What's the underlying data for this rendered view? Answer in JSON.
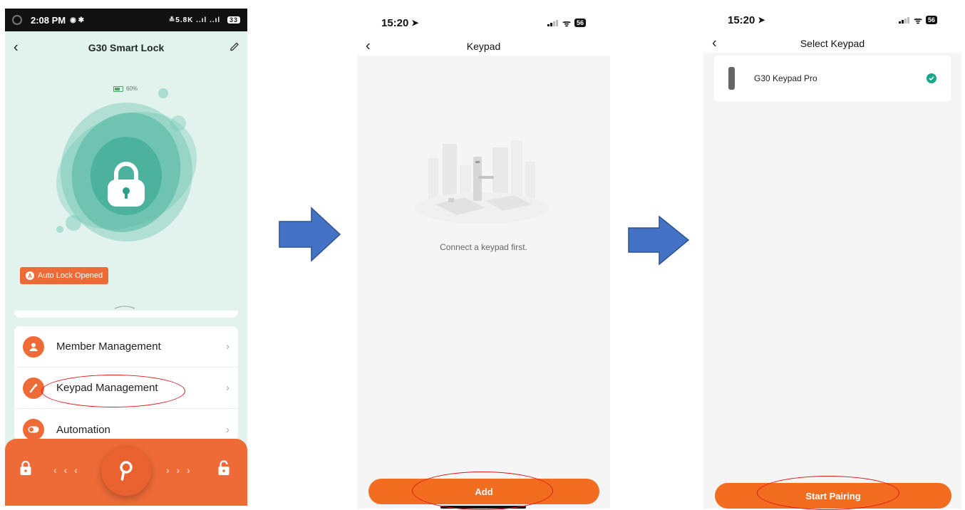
{
  "phone1": {
    "status": {
      "time": "2:08 PM",
      "indicators": "≛5.8K ..ıl ..ıl",
      "battery": "33"
    },
    "header": {
      "title": "G30 Smart Lock",
      "back_icon": "chevron-left-icon",
      "edit_icon": "edit-icon"
    },
    "battery_percent": "60%",
    "auto_lock_badge": "Auto Lock Opened",
    "menu": [
      {
        "label": "Member Management",
        "icon": "person-icon"
      },
      {
        "label": "Keypad Management",
        "icon": "keypad-icon"
      },
      {
        "label": "Automation",
        "icon": "toggle-icon"
      }
    ],
    "bottom_bar": {
      "left_arrows": "‹ ‹ ‹",
      "right_arrows": "› › ›"
    },
    "colors": {
      "accent": "#ee6b37",
      "teal": "#3fb39c",
      "bg": "#e2f2ec"
    }
  },
  "phone2": {
    "status": {
      "time": "15:20",
      "battery": "56"
    },
    "header": {
      "title": "Keypad"
    },
    "empty_text": "Connect a keypad first.",
    "button": "Add"
  },
  "phone3": {
    "status": {
      "time": "15:20",
      "battery": "56"
    },
    "header": {
      "title": "Select Keypad"
    },
    "device": {
      "name": "G30 Keypad Pro",
      "selected": true
    },
    "button": "Start Pairing"
  },
  "colors": {
    "arrow": "#4472c4",
    "annotation": "#e0161b",
    "button": "#f36d21"
  }
}
